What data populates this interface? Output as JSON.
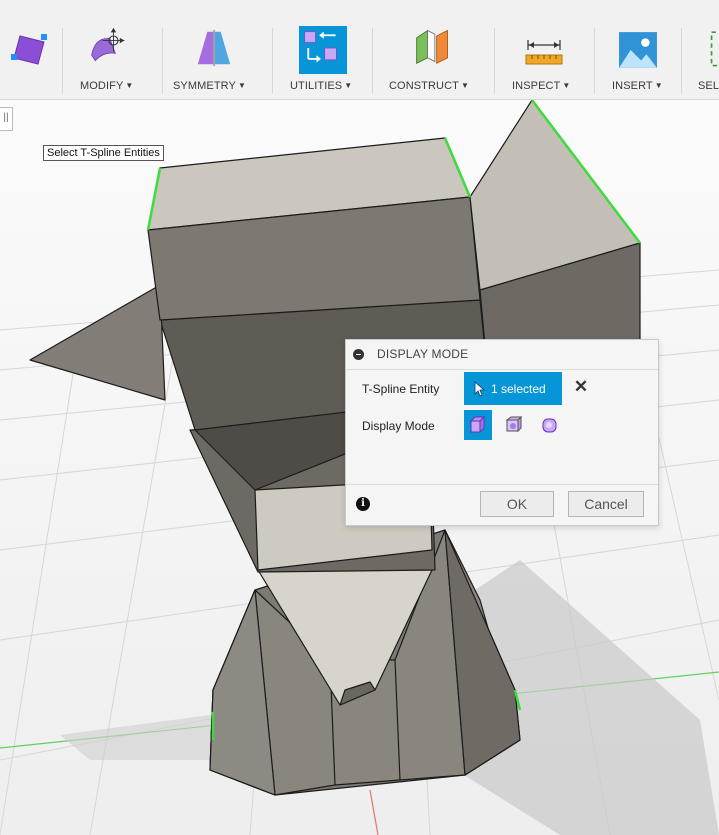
{
  "toolbar": {
    "groups": [
      {
        "label": "MODIFY",
        "icon": "modify-icon"
      },
      {
        "label": "SYMMETRY",
        "icon": "symmetry-icon"
      },
      {
        "label": "UTILITIES",
        "icon": "utilities-icon"
      },
      {
        "label": "CONSTRUCT",
        "icon": "construct-icon"
      },
      {
        "label": "INSPECT",
        "icon": "inspect-icon"
      },
      {
        "label": "INSERT",
        "icon": "insert-icon"
      },
      {
        "label": "SEL",
        "icon": "select-icon"
      }
    ],
    "caret": "▼"
  },
  "viewport": {
    "tooltip": "Select T-Spline Entities",
    "side_handle": "||"
  },
  "dialog": {
    "title": "DISPLAY MODE",
    "entity_label": "T-Spline Entity",
    "entity_value": "1 selected",
    "clear_symbol": "✕",
    "mode_label": "Display Mode",
    "modes": [
      "box-display-icon",
      "control-frame-display-icon",
      "smooth-display-icon"
    ],
    "info_symbol": "i",
    "ok_label": "OK",
    "cancel_label": "Cancel"
  },
  "colors": {
    "accent": "#0696d7",
    "selection_edge": "#3cdc3c",
    "model_face": "#8e8a82",
    "background": "#f7f7f7"
  }
}
